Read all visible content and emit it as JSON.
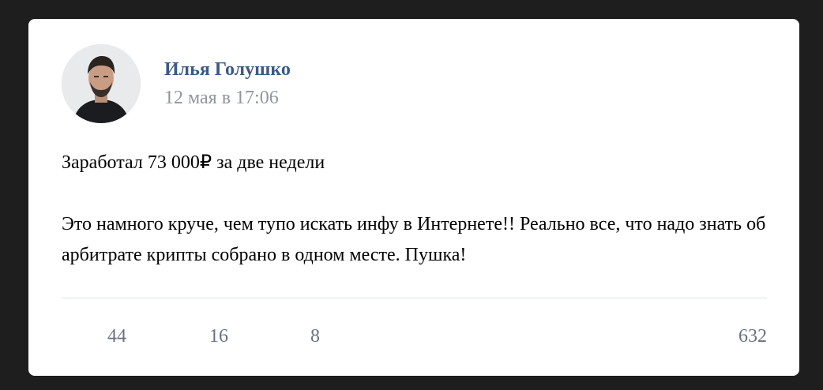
{
  "post": {
    "author_name": "Илья Голушко",
    "date": "12 мая в 17:06",
    "headline": "Заработал 73 000₽ за две недели",
    "body": "Это намного круче, чем тупо искать инфу в Интернете!! Реально все, что надо знать об арбитрате крипты собрано в одном месте. Пушка!",
    "stats": {
      "likes": "44",
      "comments": "16",
      "shares": "8",
      "views": "632"
    }
  }
}
